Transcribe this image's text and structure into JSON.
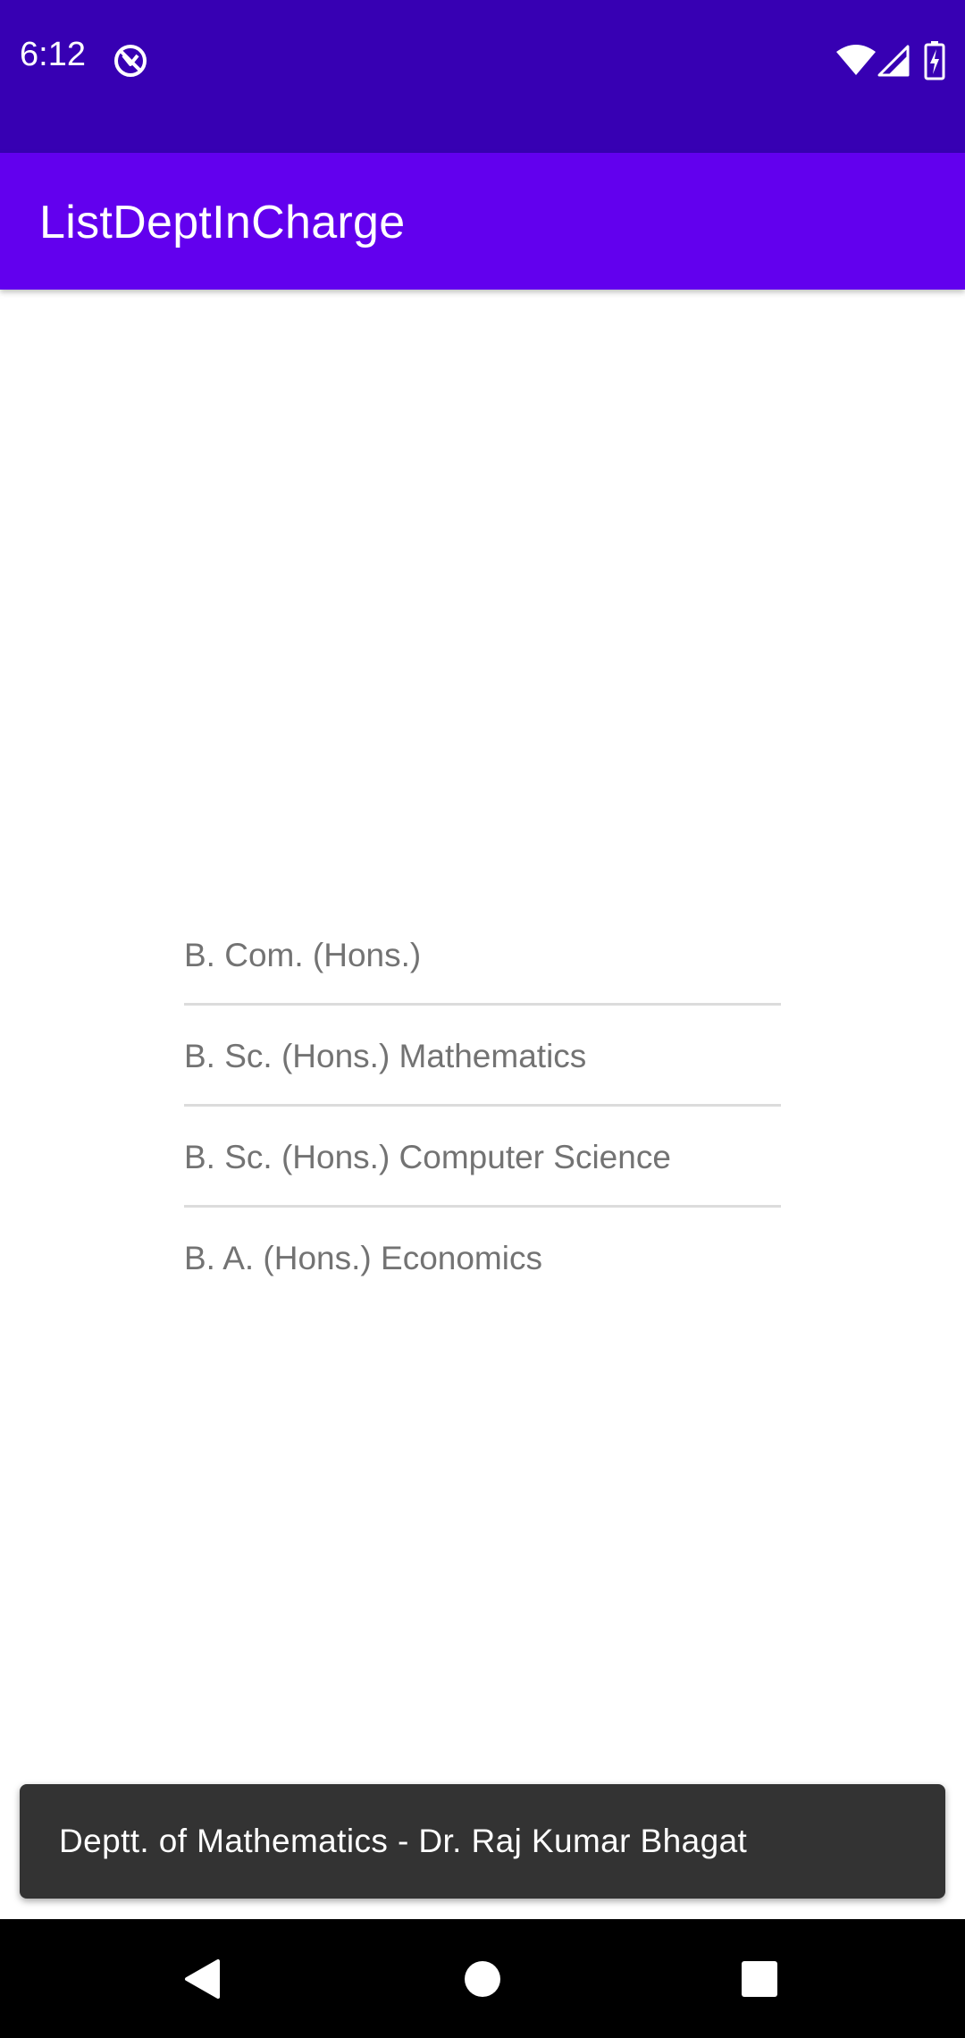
{
  "status_bar": {
    "time": "6:12",
    "icons": [
      "app-notification-icon",
      "wifi-icon",
      "cell-signal-icon",
      "battery-charging-icon"
    ]
  },
  "app_bar": {
    "title": "ListDeptInCharge"
  },
  "dept_list": {
    "items": [
      {
        "label": "B. Com. (Hons.)"
      },
      {
        "label": "B. Sc. (Hons.) Mathematics"
      },
      {
        "label": "B. Sc. (Hons.) Computer Science"
      },
      {
        "label": "B. A. (Hons.) Economics"
      }
    ]
  },
  "toast": {
    "message": "Deptt. of Mathematics - Dr. Raj Kumar Bhagat"
  },
  "nav_bar": {
    "icons": [
      "back-icon",
      "home-icon",
      "recents-icon"
    ]
  },
  "colors": {
    "status_bar": "#3700b3",
    "app_bar": "#6200ee",
    "list_text": "#737373",
    "divider": "#dcdcdc",
    "toast_bg": "#333333"
  }
}
